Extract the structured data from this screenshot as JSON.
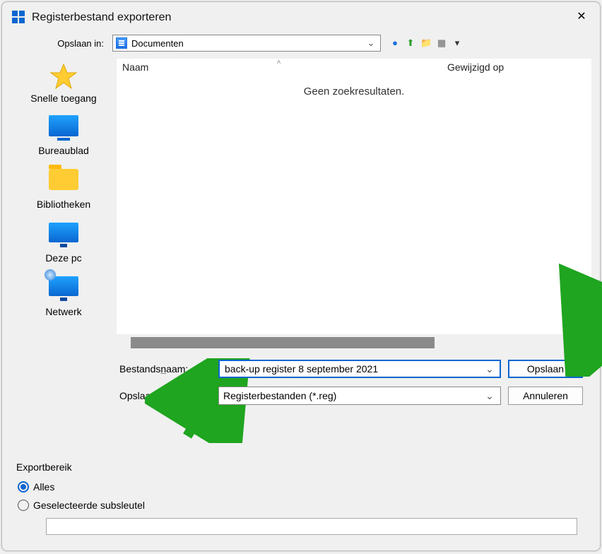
{
  "title": "Registerbestand exporteren",
  "toprow": {
    "label": "Opslaan in:",
    "location": "Documenten"
  },
  "sidebar": {
    "items": [
      {
        "label": "Snelle toegang"
      },
      {
        "label": "Bureaublad"
      },
      {
        "label": "Bibliotheken"
      },
      {
        "label": "Deze pc"
      },
      {
        "label": "Netwerk"
      }
    ]
  },
  "list": {
    "col_name": "Naam",
    "col_modified": "Gewijzigd op",
    "empty": "Geen zoekresultaten."
  },
  "filename": {
    "label_pre": "Bestands",
    "label_ul": "n",
    "label_post": "aam:",
    "value": "back-up register 8 september 2021"
  },
  "filetype": {
    "label": "Opslaan als:",
    "value": "Registerbestanden (*.reg)"
  },
  "buttons": {
    "save": "Opslaan",
    "cancel": "Annuleren"
  },
  "export": {
    "legend": "Exportbereik",
    "all": "Alles",
    "selected": "Geselecteerde subsleutel"
  }
}
